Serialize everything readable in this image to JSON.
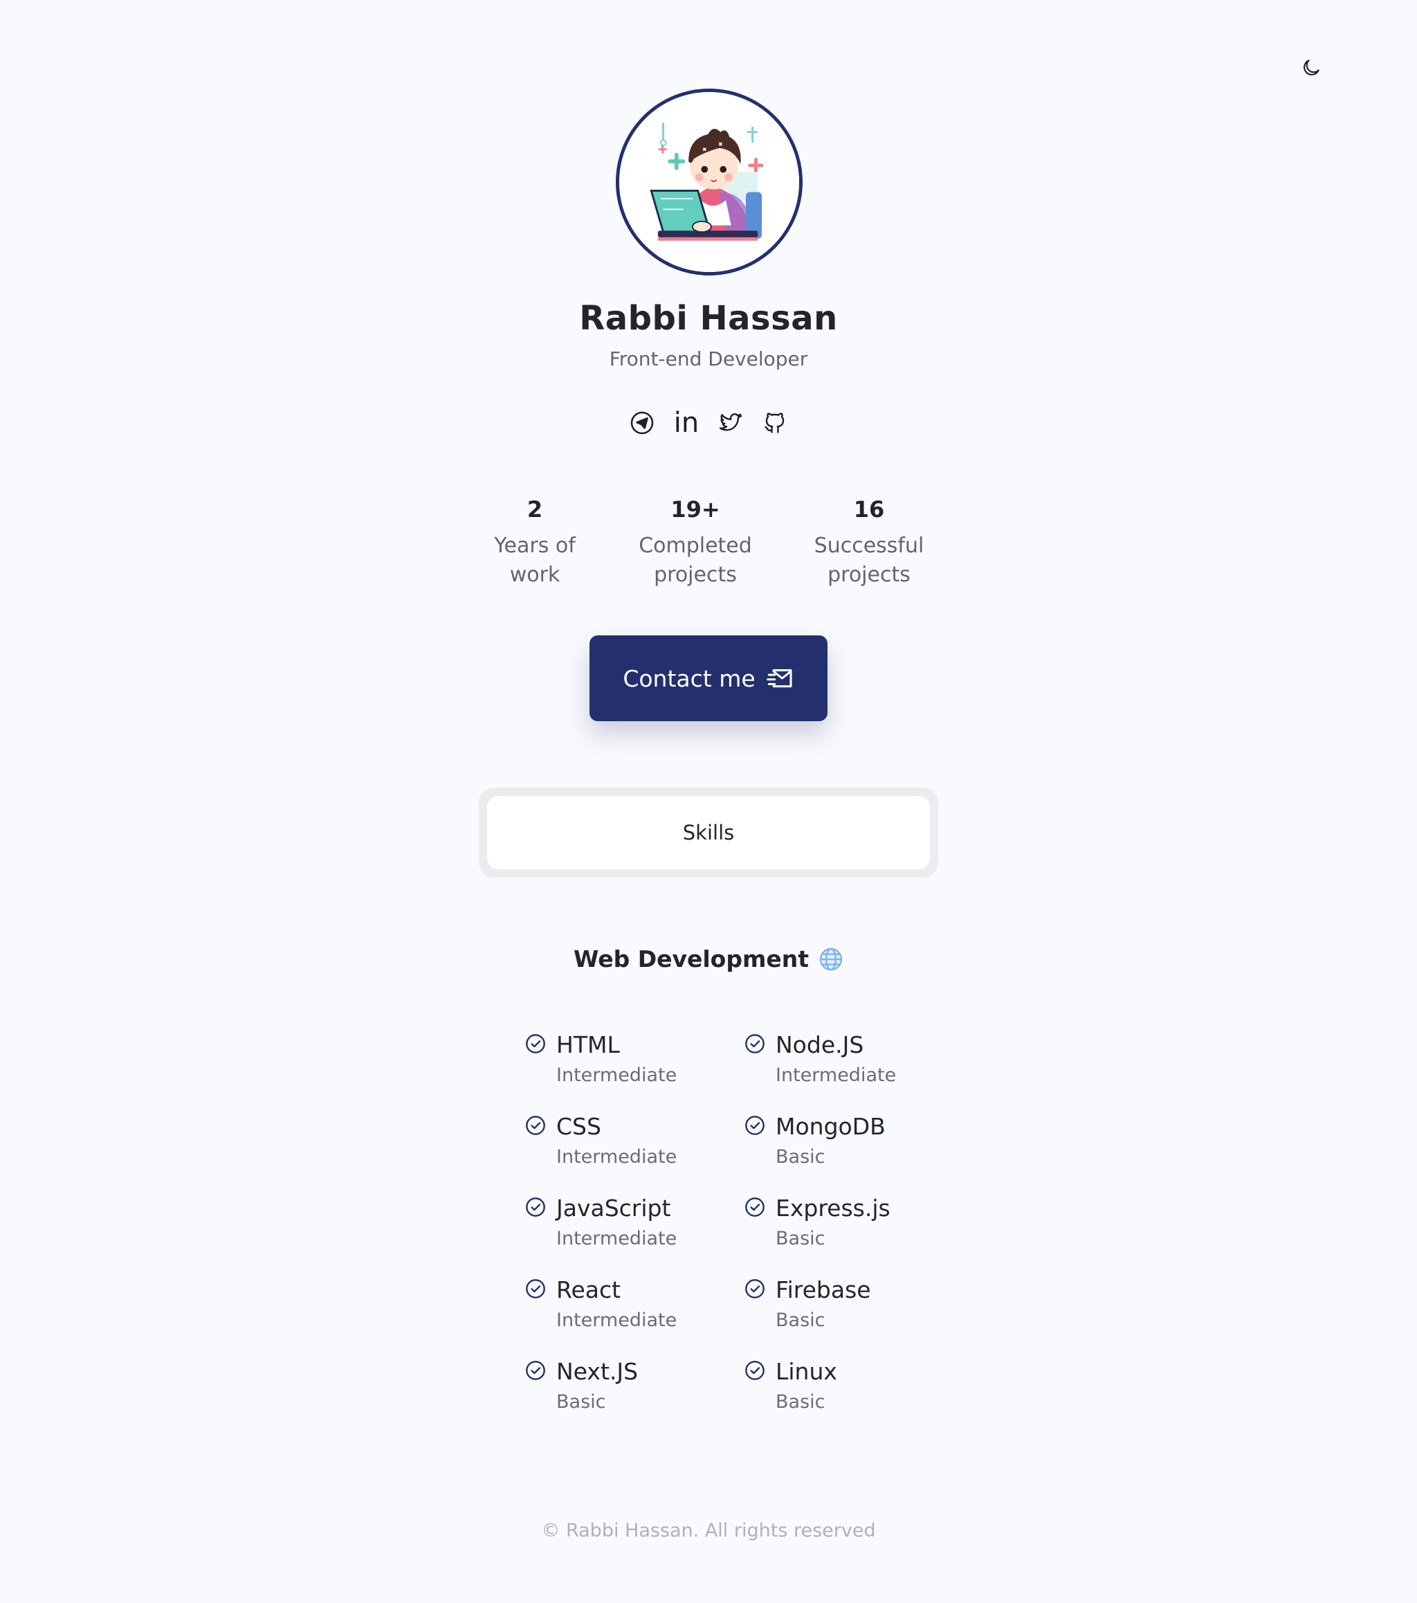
{
  "header": {
    "theme_toggle_icon": "moon-icon"
  },
  "profile": {
    "name": "Rabbi Hassan",
    "role": "Front-end Developer",
    "avatar_description_icon": "developer-avatar-illustration"
  },
  "socials": [
    {
      "icon": "telegram-icon"
    },
    {
      "icon": "linkedin-icon",
      "text": "in"
    },
    {
      "icon": "twitter-icon"
    },
    {
      "icon": "github-icon"
    }
  ],
  "stats": [
    {
      "value": "2",
      "label_line1": "Years of",
      "label_line2": "work"
    },
    {
      "value": "19+",
      "label_line1": "Completed",
      "label_line2": "projects"
    },
    {
      "value": "16",
      "label_line1": "Successful",
      "label_line2": "projects"
    }
  ],
  "contact": {
    "label": "Contact me",
    "icon": "send-mail-icon"
  },
  "tabs": {
    "skills_label": "Skills"
  },
  "section": {
    "title": "Web Development",
    "icon": "globe-icon"
  },
  "skills": {
    "left": [
      {
        "name": "HTML",
        "level": "Intermediate"
      },
      {
        "name": "CSS",
        "level": "Intermediate"
      },
      {
        "name": "JavaScript",
        "level": "Intermediate"
      },
      {
        "name": "React",
        "level": "Intermediate"
      },
      {
        "name": "Next.JS",
        "level": "Basic"
      }
    ],
    "right": [
      {
        "name": "Node.JS",
        "level": "Intermediate"
      },
      {
        "name": "MongoDB",
        "level": "Basic"
      },
      {
        "name": "Express.js",
        "level": "Basic"
      },
      {
        "name": "Firebase",
        "level": "Basic"
      },
      {
        "name": "Linux",
        "level": "Basic"
      }
    ]
  },
  "footer": {
    "text": "© Rabbi Hassan. All rights reserved"
  },
  "colors": {
    "background": "#f9fafd",
    "primary": "#24306d",
    "text": "#24242a",
    "muted": "#636373",
    "footer": "#b0b0ba",
    "globe": "#7fb4ea"
  }
}
